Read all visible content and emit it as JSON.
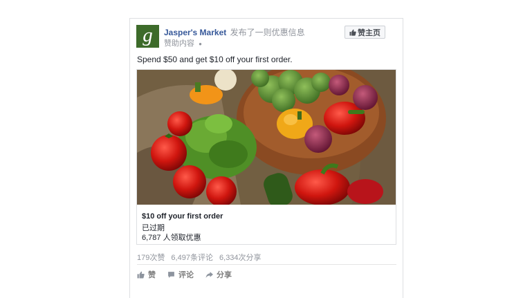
{
  "post": {
    "logo_letter": "g",
    "page_name": "Jasper's Market",
    "action_text": "发布了一则优惠信息",
    "meta": "赞助内容",
    "like_page_label": "赞主页",
    "text": "Spend $50 and get $10 off your first order."
  },
  "offer": {
    "title": "$10 off your first order",
    "status": "已过期",
    "claims": "6,787 人领取优惠"
  },
  "stats": {
    "likes": "179次赞",
    "comments": "6,497条评论",
    "shares": "6,334次分享"
  },
  "actions": {
    "like": "赞",
    "comment": "评论",
    "share": "分享"
  },
  "colors": {
    "link_blue": "#365899",
    "logo_green": "#3d6b2a",
    "muted_grey": "#90949c"
  }
}
